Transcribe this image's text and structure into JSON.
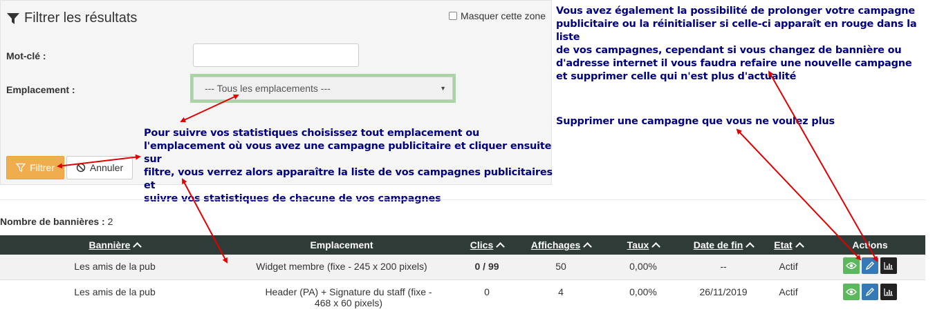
{
  "filter": {
    "title": "Filtrer les résultats",
    "hide_label": "Masquer cette zone",
    "keyword_label": "Mot-clé :",
    "keyword_value": "",
    "location_label": "Emplacement :",
    "location_selected": "--- Tous les emplacements ---",
    "filter_button": "Filtrer",
    "cancel_button": "Annuler"
  },
  "annotations": {
    "filter_help": [
      "Pour suivre vos statistiques choisissez tout emplacement ou",
      "l'emplacement où vous avez une campagne publicitaire et cliquer ensuite sur",
      "filtre, vous verrez alors apparaître la liste de vos campagnes publicitaires et",
      "suivre vos statistiques de chacune de vos campagnes"
    ],
    "prolong_help": [
      "Vous avez également la possibilité de prolonger votre campagne",
      "publicitaire ou la réinitialiser si celle-ci apparaît en rouge dans la liste",
      "de vos campagnes, cependant si vous changez de bannière ou",
      "d'adresse internet il vous faudra refaire une nouvelle campagne",
      "et supprimer celle qui n'est plus d'actualité"
    ],
    "delete_help": "Supprimer une campagne que vous ne voulez plus"
  },
  "summary": {
    "count_label": "Nombre de bannières :",
    "count_value": "2"
  },
  "table": {
    "headers": {
      "banner": "Bannière",
      "location": "Emplacement",
      "clicks": "Clics",
      "views": "Affichages",
      "rate": "Taux",
      "end_date": "Date de fin",
      "state": "Etat",
      "actions": "Actions"
    },
    "rows": [
      {
        "banner": "Les amis de la pub",
        "location": "Widget membre (fixe - 245 x 200 pixels)",
        "clicks": "0 / 99",
        "views": "50",
        "rate": "0,00%",
        "end_date": "--",
        "state": "Actif"
      },
      {
        "banner": "Les amis de la pub",
        "location": "Header (PA) + Signature du staff (fixe - 468 x 60 pixels)",
        "clicks": "0",
        "views": "4",
        "rate": "0,00%",
        "end_date": "26/11/2019",
        "state": "Actif"
      }
    ]
  },
  "colors": {
    "annotation_text": "#000080",
    "arrow": "#e00000",
    "filter_button": "#f0ad4e",
    "header_bg": "#2f3b37",
    "view_button": "#5cb85c",
    "edit_button": "#337ab7",
    "stats_button": "#222222"
  },
  "icons": [
    "funnel-icon",
    "ban-icon",
    "eye-icon",
    "pencil-icon",
    "bar-chart-icon",
    "sort-chevron-up-icon"
  ]
}
